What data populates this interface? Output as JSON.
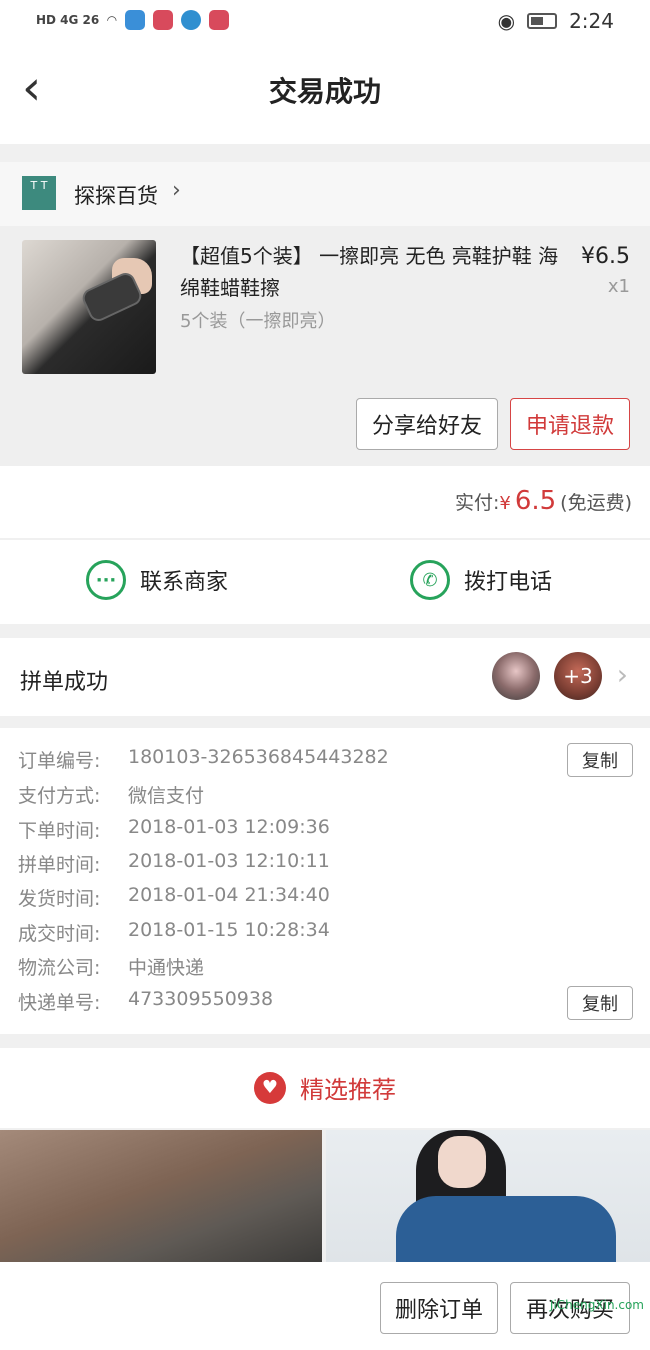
{
  "status_bar": {
    "indicators": "HD 4G 26",
    "time": "2:24"
  },
  "header": {
    "title": "交易成功",
    "back_icon": "‹"
  },
  "shop": {
    "name": "探探百货"
  },
  "product": {
    "title": "【超值5个装】 一擦即亮 无色 亮鞋护鞋 海绵鞋蜡鞋擦",
    "spec": "5个装（一擦即亮）",
    "price": "¥6.5",
    "quantity": "x1"
  },
  "actions": {
    "share": "分享给好友",
    "refund": "申请退款"
  },
  "payment": {
    "label": "实付:",
    "currency": "¥",
    "amount": "6.5",
    "note": "(免运费)"
  },
  "contact": {
    "merchant": "联系商家",
    "call": "拨打电话"
  },
  "group": {
    "label": "拼单成功",
    "extra_count": "+3"
  },
  "order_info": {
    "rows": [
      {
        "label": "订单编号:",
        "value": "180103-326536845443282"
      },
      {
        "label": "支付方式:",
        "value": "微信支付"
      },
      {
        "label": "下单时间:",
        "value": "2018-01-03 12:09:36"
      },
      {
        "label": "拼单时间:",
        "value": "2018-01-03 12:10:11"
      },
      {
        "label": "发货时间:",
        "value": "2018-01-04 21:34:40"
      },
      {
        "label": "成交时间:",
        "value": "2018-01-15 10:28:34"
      },
      {
        "label": "物流公司:",
        "value": "中通快递"
      },
      {
        "label": "快递单号:",
        "value": "473309550938"
      }
    ],
    "copy_label": "复制"
  },
  "recommend": {
    "label": "精选推荐"
  },
  "bottom": {
    "delete": "删除订单",
    "rebuy": "再次购买"
  },
  "watermark": "JiChengXin.com",
  "colors": {
    "accent_red": "#d13a3a",
    "wechat_green": "#27a35b"
  }
}
